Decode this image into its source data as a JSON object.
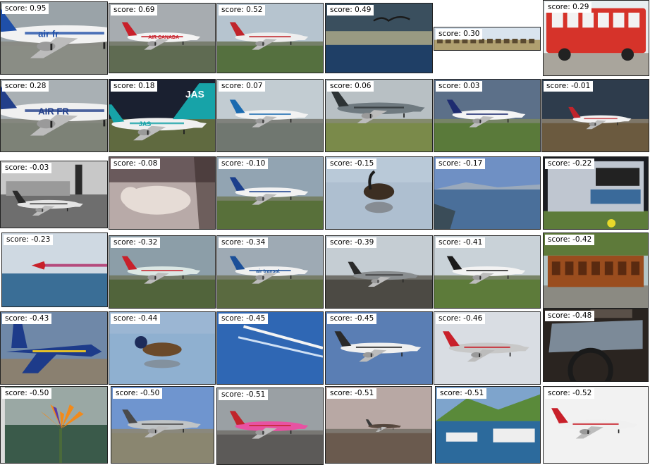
{
  "label_prefix": "score: ",
  "tiles": [
    {
      "score": "0.95",
      "kind": "plane-closeup",
      "sky": "#9aa3a8",
      "ground": "#8a8d85",
      "body": "#f2f2f2",
      "accent": "#1f4fa8",
      "text": "air fr"
    },
    {
      "score": "0.69",
      "kind": "plane",
      "sky": "#a7acb0",
      "ground": "#5f6b52",
      "body": "#f4f4f4",
      "accent": "#c8202a",
      "text": "AIR CANADA"
    },
    {
      "score": "0.52",
      "kind": "plane",
      "sky": "#b6c4cf",
      "ground": "#55703f",
      "body": "#eeeeee",
      "accent": "#c0242b"
    },
    {
      "score": "0.49",
      "kind": "bird-sea",
      "sky": "#3a4f5e",
      "ground": "#1f3f66",
      "body": "#1a1a1a",
      "accent": "#e8d9a0"
    },
    {
      "score": "0.30",
      "kind": "landscape",
      "sky": "#d9e4ee",
      "ground": "#b0a070",
      "body": "#5a4a30",
      "accent": "#3a3a3a"
    },
    {
      "score": "0.29",
      "kind": "bus",
      "sky": "#e8eef0",
      "ground": "#a9a59c",
      "body": "#d6332a",
      "accent": "#f2f2f2"
    },
    {
      "score": "0.28",
      "kind": "plane-closeup",
      "sky": "#a9b0b4",
      "ground": "#7d8277",
      "body": "#f0f0f0",
      "accent": "#223f8a",
      "text": "AIR FR"
    },
    {
      "score": "0.18",
      "kind": "tail",
      "sky": "#1a2030",
      "ground": "#606a40",
      "body": "#f0f0f0",
      "accent": "#17a3a8",
      "text": "JAS"
    },
    {
      "score": "0.07",
      "kind": "plane",
      "sky": "#c2ccd2",
      "ground": "#707770",
      "body": "#f2f2f2",
      "accent": "#1a6ab0"
    },
    {
      "score": "0.06",
      "kind": "fighter",
      "sky": "#b8c0c4",
      "ground": "#7a8a4a",
      "body": "#6f7a80",
      "accent": "#2d3335"
    },
    {
      "score": "0.03",
      "kind": "plane",
      "sky": "#5c7089",
      "ground": "#5a7a3a",
      "body": "#f4f4f4",
      "accent": "#1e2c70"
    },
    {
      "score": "-0.01",
      "kind": "jet-small",
      "sky": "#2e3c4c",
      "ground": "#6b5a3f",
      "body": "#f2f2f2",
      "accent": "#c0242b"
    },
    {
      "score": "-0.03",
      "kind": "bw-airport",
      "sky": "#c8c8c8",
      "ground": "#6e6e6e",
      "body": "#e4e4e4",
      "accent": "#2a2a2a"
    },
    {
      "score": "-0.08",
      "kind": "cat",
      "sky": "#6a5a5c",
      "ground": "#b8aaa8",
      "body": "#e6dcd6",
      "accent": "#3a2c2a"
    },
    {
      "score": "-0.10",
      "kind": "plane",
      "sky": "#92a4b2",
      "ground": "#58703a",
      "body": "#f2f2f2",
      "accent": "#1b3f8c"
    },
    {
      "score": "-0.15",
      "kind": "goose-water",
      "sky": "#b9c9d8",
      "ground": "#aebfd0",
      "body": "#3c2e22",
      "accent": "#1c1c1c"
    },
    {
      "score": "-0.17",
      "kind": "sea",
      "sky": "#6f90c4",
      "ground": "#4a6f9a",
      "body": "#3a4c58",
      "accent": "#9aa9bb"
    },
    {
      "score": "-0.22",
      "kind": "screen",
      "sky": "#1b1d22",
      "ground": "#5d7c3a",
      "body": "#bfc6d0",
      "accent": "#e8d92a"
    },
    {
      "score": "-0.23",
      "kind": "jet-trail",
      "sky": "#cfd9e2",
      "ground": "#3a6e96",
      "body": "#c8202a",
      "accent": "#b0306a"
    },
    {
      "score": "-0.32",
      "kind": "plane",
      "sky": "#8c9ea8",
      "ground": "#51643b",
      "body": "#dbe7e4",
      "accent": "#c8202a"
    },
    {
      "score": "-0.34",
      "kind": "plane",
      "sky": "#9eaab4",
      "ground": "#5a6a40",
      "body": "#f0f0f0",
      "accent": "#1b4f98",
      "text": "air transat"
    },
    {
      "score": "-0.39",
      "kind": "small-prop",
      "sky": "#c5cdd3",
      "ground": "#4c4a44",
      "body": "#8a8e90",
      "accent": "#2a2a2a"
    },
    {
      "score": "-0.41",
      "kind": "plane",
      "sky": "#c9d2d8",
      "ground": "#5d7b3a",
      "body": "#f3f3f3",
      "accent": "#1a1a1a"
    },
    {
      "score": "-0.42",
      "kind": "train",
      "sky": "#b4c6c8",
      "ground": "#8b8a82",
      "body": "#9a4d1e",
      "accent": "#5e7a3a"
    },
    {
      "score": "-0.43",
      "kind": "fighter-blue",
      "sky": "#6f88a8",
      "ground": "#8a8070",
      "body": "#1d3b8a",
      "accent": "#e4c028"
    },
    {
      "score": "-0.44",
      "kind": "duck-water",
      "sky": "#9bb6d3",
      "ground": "#8fb0d0",
      "body": "#6b4a2a",
      "accent": "#1d2c5a"
    },
    {
      "score": "-0.45",
      "kind": "contrails",
      "sky": "#2f67b4",
      "ground": "#2f67b4",
      "body": "#f4f4f4",
      "accent": "#cfe0f4"
    },
    {
      "score": "-0.45",
      "kind": "plane-sky",
      "sky": "#5a7eb4",
      "ground": "#5a7eb4",
      "body": "#f0f0f0",
      "accent": "#2a2a2a"
    },
    {
      "score": "-0.46",
      "kind": "plane-sky",
      "sky": "#d9dde3",
      "ground": "#d9dde3",
      "body": "#c8c8c8",
      "accent": "#c8202a"
    },
    {
      "score": "-0.48",
      "kind": "car-interior",
      "sky": "#7c8a98",
      "ground": "#2a2420",
      "body": "#5a5048",
      "accent": "#1a1a1a"
    },
    {
      "score": "-0.50",
      "kind": "flower",
      "sky": "#9aa8a4",
      "ground": "#3a5a4a",
      "body": "#f28a1a",
      "accent": "#5a3aa8"
    },
    {
      "score": "-0.50",
      "kind": "plane",
      "sky": "#6f95cf",
      "ground": "#8a8670",
      "body": "#c0c4c6",
      "accent": "#4a4a4a"
    },
    {
      "score": "-0.51",
      "kind": "plane",
      "sky": "#9aa0a4",
      "ground": "#5c5a58",
      "body": "#e852a2",
      "accent": "#c0242b"
    },
    {
      "score": "-0.51",
      "kind": "plane-far",
      "sky": "#b8a8a4",
      "ground": "#6a5a4e",
      "body": "#5a4a40",
      "accent": "#3a3a3a"
    },
    {
      "score": "-0.51",
      "kind": "harbor",
      "sky": "#7ea4cc",
      "ground": "#2c6a9c",
      "body": "#eeeeee",
      "accent": "#5a8a3a"
    },
    {
      "score": "-0.52",
      "kind": "plane-sky",
      "sky": "#f2f2f2",
      "ground": "#f2f2f2",
      "body": "#f0f0f0",
      "accent": "#c8202a"
    }
  ]
}
